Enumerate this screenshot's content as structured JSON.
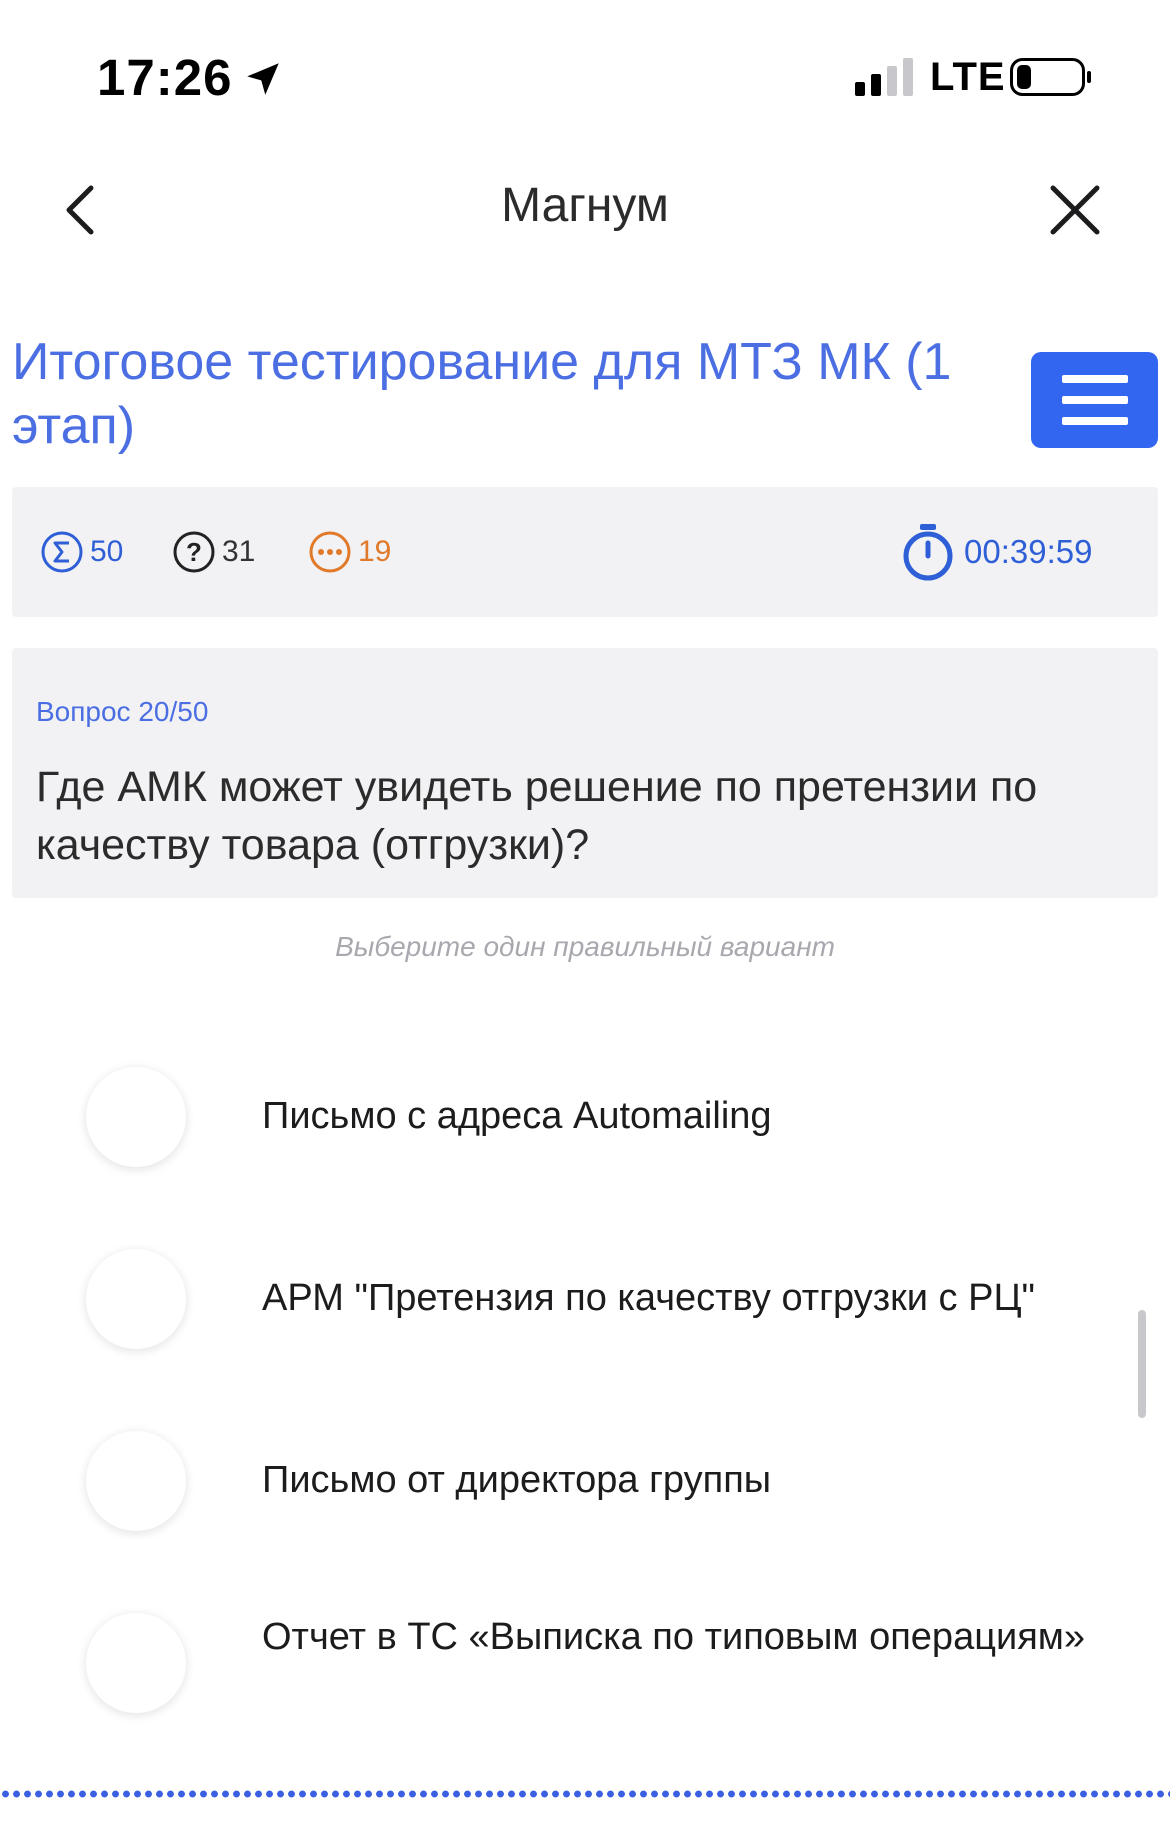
{
  "status_bar": {
    "time": "17:26",
    "network": "LTE",
    "icons": [
      "location-arrow-icon",
      "signal-bars-icon",
      "battery-icon"
    ]
  },
  "nav": {
    "title": "Магнум",
    "back_icon": "chevron-left-icon",
    "close_icon": "close-icon"
  },
  "course": {
    "title": " Итоговое тестирование для МТЗ МК (1 этап)",
    "menu_icon": "hamburger-menu-icon"
  },
  "stats": {
    "total": "50",
    "unanswered": "31",
    "skipped": "19",
    "timer": "00:39:59",
    "colors": {
      "accent": "#2f5fd6",
      "skipped": "#e07a2a"
    }
  },
  "question": {
    "number": "Вопрос 20/50",
    "text": "Где АМК может увидеть решение по претензии по качеству товара (отгрузки)?"
  },
  "hint": "Выберите один правильный вариант",
  "options": [
    {
      "label": "Письмо с адреса Automailing",
      "selected": false
    },
    {
      "label": "АРМ \"Претензия по качеству отгрузки с РЦ\"",
      "selected": false
    },
    {
      "label": "Письмо от директора группы",
      "selected": false
    },
    {
      "label": "Отчет в ТС «Выписка по типовым операциям»",
      "selected": false
    }
  ],
  "colors": {
    "primary": "#3366f0",
    "title_blue": "#4b6ee3",
    "panel_bg": "#f2f2f5"
  }
}
